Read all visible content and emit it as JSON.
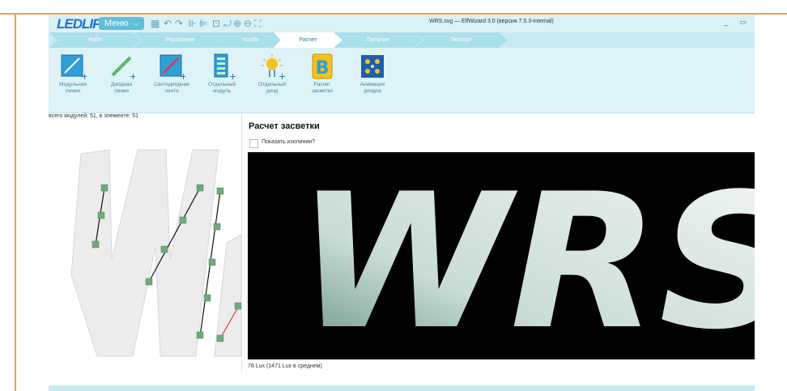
{
  "app": {
    "logo": "LEDLIF",
    "menu_label": "Меню",
    "window_title": "WRS.svg — ElfWizard 3.0 (версия 7.5.3-internal)",
    "window_controls": "_ ▭"
  },
  "tabs": [
    {
      "label": "Файл",
      "active": false
    },
    {
      "label": "Рисование",
      "active": false
    },
    {
      "label": "Колба",
      "active": false
    },
    {
      "label": "Расчет",
      "active": true
    },
    {
      "label": "Питание",
      "active": false
    },
    {
      "label": "Экспорт",
      "active": false
    }
  ],
  "ribbon": [
    {
      "label1": "Модульная",
      "label2": "линия",
      "icon": "module-line-icon"
    },
    {
      "label1": "Диодная",
      "label2": "линия",
      "icon": "diode-line-icon"
    },
    {
      "label1": "Светодиодная",
      "label2": "лента",
      "icon": "led-strip-icon"
    },
    {
      "label1": "Отдельный",
      "label2": "модуль",
      "icon": "single-module-icon"
    },
    {
      "label1": "Отдельный",
      "label2": "диод",
      "icon": "single-diode-icon"
    },
    {
      "label1": "Расчет",
      "label2": "засветки",
      "icon": "illumination-calc-icon"
    },
    {
      "label1": "Анимация",
      "label2": "диодов",
      "icon": "diode-animation-icon"
    }
  ],
  "status_text": "всего модулей: 51, в элементе: 51",
  "dialog": {
    "title": "Расчет засветки",
    "checkbox_label": "Показать изолинии?",
    "checkbox_checked": false,
    "render_text": "WRS",
    "lux_text": "78 Lux (1471 Lux в среднем)"
  },
  "colors": {
    "accent": "#5fc0d8",
    "tab_active": "#ffffff",
    "tab_inactive": "#a9dfeb",
    "frame": "#f0a04a"
  }
}
